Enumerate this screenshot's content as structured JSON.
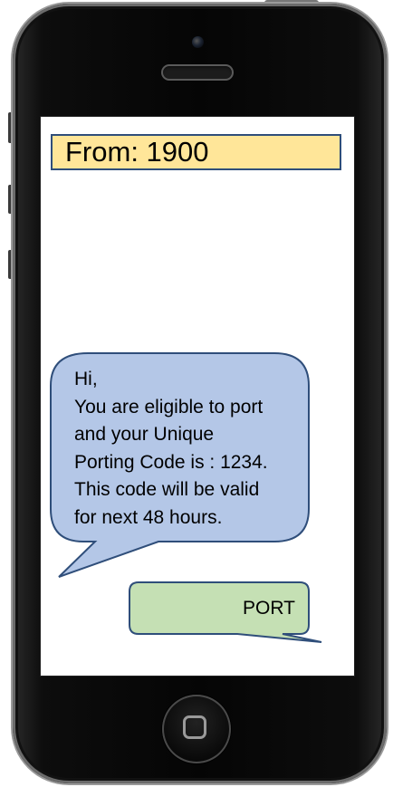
{
  "sms": {
    "from_label": "From: 1900",
    "message_lines": [
      "Hi,",
      "You are eligible to port",
      "and your Unique",
      "Porting Code is : 1234.",
      "This code will be valid",
      "for next 48 hours."
    ],
    "reply_label": "PORT"
  },
  "colors": {
    "header_fill": "#ffe699",
    "incoming_bubble_fill": "#b4c7e7",
    "outgoing_bubble_fill": "#c5e0b4",
    "bubble_border": "#2f4e7a"
  },
  "icons": {
    "home": "home-button-icon",
    "camera": "front-camera-icon",
    "speaker": "earpiece-speaker-icon"
  }
}
